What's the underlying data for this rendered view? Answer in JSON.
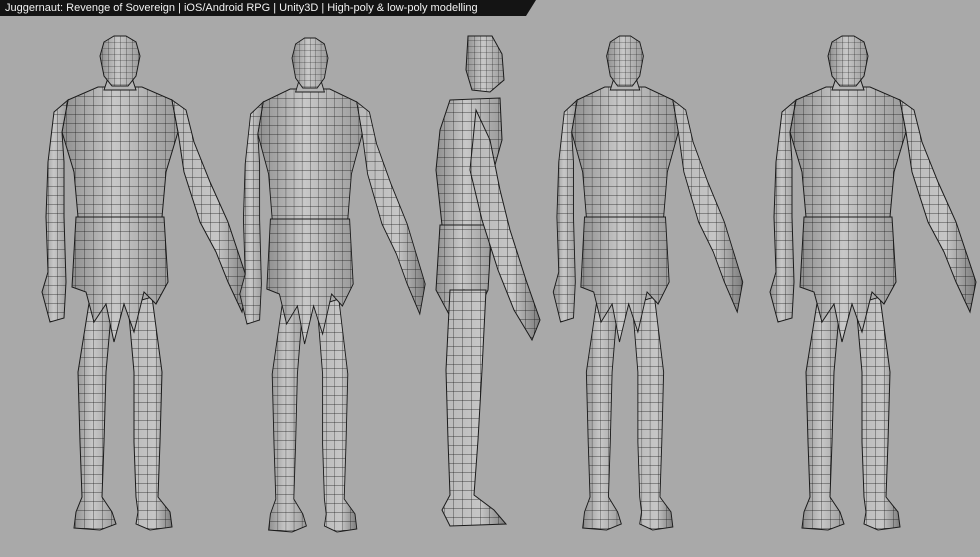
{
  "caption": {
    "text": "Juggernaut: Revenge of Sovereign | iOS/Android RPG | Unity3D | High-poly & low-poly modelling"
  },
  "viewport": {
    "background_color": "#a9a9a9",
    "caption_bar_color": "#141414",
    "mesh_fill_color": "#c4c4c4",
    "mesh_shade_color": "#8e8e8e",
    "wire_color": "#1a1a1a"
  },
  "models": [
    {
      "view": "front"
    },
    {
      "view": "three-quarter-front"
    },
    {
      "view": "side"
    },
    {
      "view": "three-quarter-back"
    },
    {
      "view": "back"
    }
  ]
}
